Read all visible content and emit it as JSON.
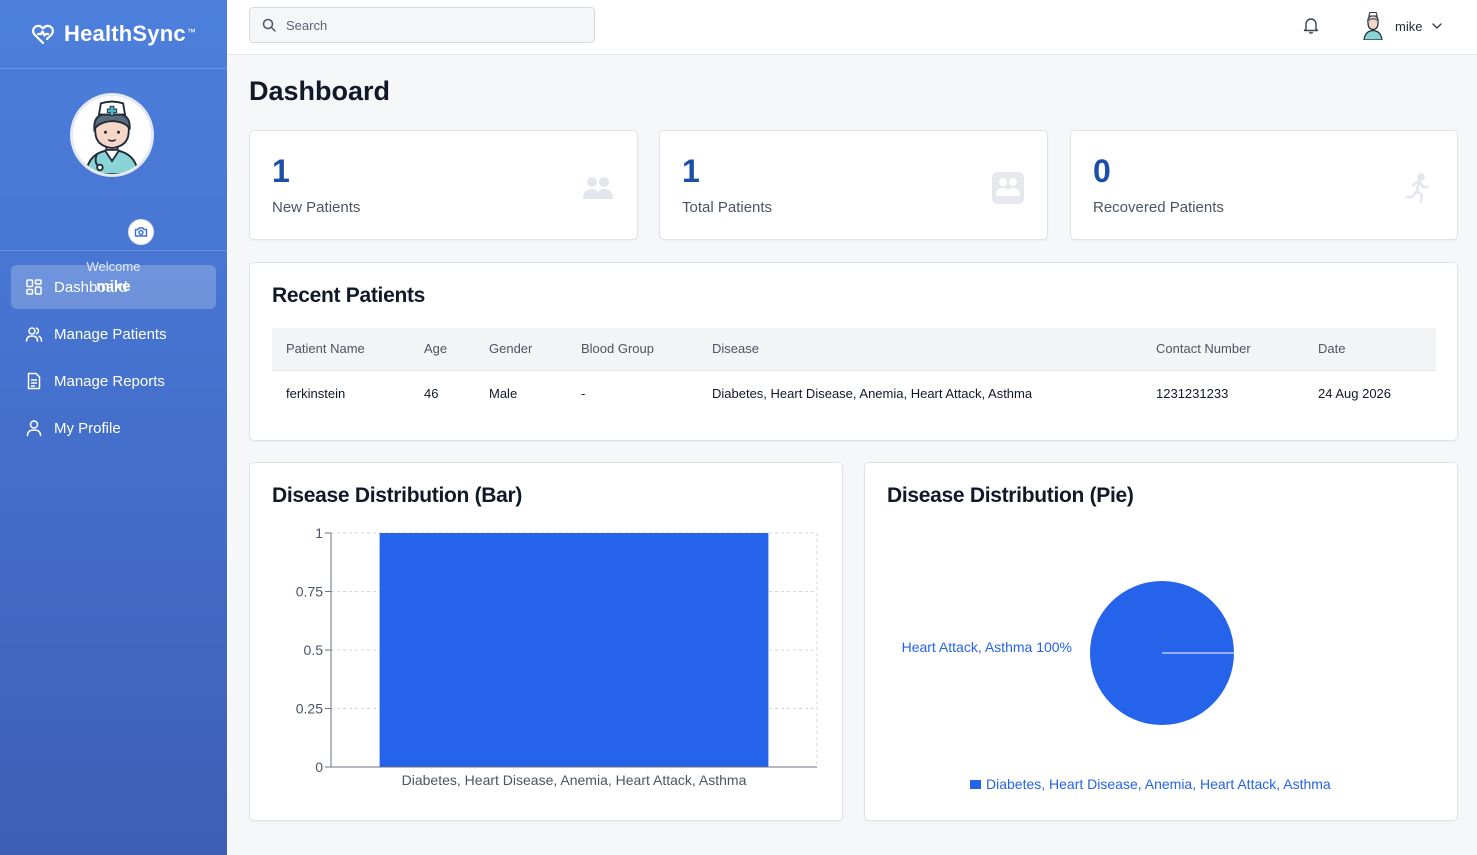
{
  "app": {
    "name": "HealthSync",
    "tm": "™"
  },
  "sidebar": {
    "welcome": "Welcome",
    "username": "mike",
    "items": [
      {
        "label": "Dashboard",
        "icon": "grid-icon",
        "active": true
      },
      {
        "label": "Manage Patients",
        "icon": "users-icon",
        "active": false
      },
      {
        "label": "Manage Reports",
        "icon": "document-icon",
        "active": false
      },
      {
        "label": "My Profile",
        "icon": "user-icon",
        "active": false
      }
    ]
  },
  "topbar": {
    "search_placeholder": "Search",
    "username": "mike"
  },
  "page": {
    "title": "Dashboard"
  },
  "stats": [
    {
      "value": "1",
      "label": "New Patients",
      "icon": "people-icon"
    },
    {
      "value": "1",
      "label": "Total Patients",
      "icon": "group-icon"
    },
    {
      "value": "0",
      "label": "Recovered Patients",
      "icon": "running-person-icon"
    }
  ],
  "recent": {
    "title": "Recent Patients",
    "columns": [
      "Patient Name",
      "Age",
      "Gender",
      "Blood Group",
      "Disease",
      "Contact Number",
      "Date"
    ],
    "rows": [
      [
        "ferkinstein",
        "46",
        "Male",
        "-",
        "Diabetes, Heart Disease, Anemia, Heart Attack, Asthma",
        "1231231233",
        "24 Aug 2026"
      ]
    ]
  },
  "colors": {
    "accent": "#2563eb",
    "brand": "#4d7fdc",
    "stat": "#1d4fa8"
  },
  "chart_data": [
    {
      "type": "bar",
      "title": "Disease Distribution (Bar)",
      "categories": [
        "Diabetes, Heart Disease, Anemia, Heart Attack, Asthma"
      ],
      "values": [
        1
      ],
      "ylim": [
        0,
        1
      ],
      "yticks": [
        "0",
        "0.25",
        "0.5",
        "0.75",
        "1"
      ],
      "grid": true
    },
    {
      "type": "pie",
      "title": "Disease Distribution (Pie)",
      "labels": [
        "Diabetes, Heart Disease, Anemia, Heart Attack, Asthma"
      ],
      "values": [
        100
      ],
      "slice_label": "Heart Attack, Asthma 100%",
      "legend": [
        "Diabetes, Heart Disease, Anemia, Heart Attack, Asthma"
      ],
      "legend_position": "bottom"
    }
  ]
}
